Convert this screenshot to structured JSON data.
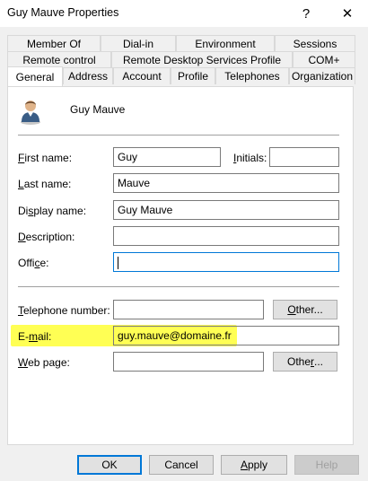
{
  "window": {
    "title": "Guy Mauve Properties",
    "help_glyph": "?",
    "close_glyph": "✕"
  },
  "tabs": {
    "row1": [
      "Member Of",
      "Dial-in",
      "Environment",
      "Sessions"
    ],
    "row2": [
      "Remote control",
      "Remote Desktop Services Profile",
      "COM+"
    ],
    "row3": [
      "General",
      "Address",
      "Account",
      "Profile",
      "Telephones",
      "Organization"
    ],
    "active": "General"
  },
  "user": {
    "display_name": "Guy Mauve",
    "icon": "user-icon"
  },
  "form": {
    "first_name": {
      "label_mnemonic": "F",
      "label_rest": "irst name:",
      "value": "Guy"
    },
    "initials": {
      "label_mnemonic": "I",
      "label_rest": "nitials:",
      "value": ""
    },
    "last_name": {
      "label_mnemonic": "L",
      "label_rest": "ast name:",
      "value": "Mauve"
    },
    "display_name": {
      "label_pre": "Di",
      "label_mnemonic": "s",
      "label_rest": "play name:",
      "value": "Guy Mauve"
    },
    "description": {
      "label_mnemonic": "D",
      "label_rest": "escription:",
      "value": ""
    },
    "office": {
      "label_pre": "Offi",
      "label_mnemonic": "c",
      "label_rest": "e:",
      "value": ""
    },
    "telephone": {
      "label_mnemonic": "T",
      "label_rest": "elephone number:",
      "value": "",
      "other_mnemonic": "O",
      "other_rest": "ther..."
    },
    "email": {
      "label_pre": "E-",
      "label_mnemonic": "m",
      "label_rest": "ail:",
      "value": "guy.mauve@domaine.fr"
    },
    "web_page": {
      "label_mnemonic": "W",
      "label_rest": "eb page:",
      "value": "",
      "other_pre": "Othe",
      "other_mnemonic": "r",
      "other_rest": "..."
    }
  },
  "buttons": {
    "ok": "OK",
    "cancel": "Cancel",
    "apply_mnemonic": "A",
    "apply_rest": "pply",
    "help": "Help"
  },
  "colors": {
    "highlight": "#ffff54",
    "focus_border": "#0078d7",
    "dialog_bg": "#f0f0f0"
  }
}
